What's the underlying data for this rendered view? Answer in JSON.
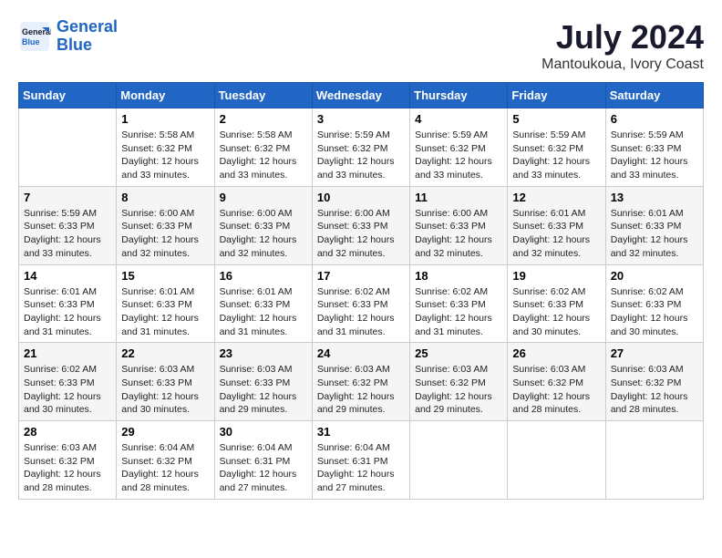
{
  "header": {
    "logo_line1": "General",
    "logo_line2": "Blue",
    "month": "July 2024",
    "location": "Mantoukoua, Ivory Coast"
  },
  "weekdays": [
    "Sunday",
    "Monday",
    "Tuesday",
    "Wednesday",
    "Thursday",
    "Friday",
    "Saturday"
  ],
  "weeks": [
    [
      {
        "day": "",
        "info": ""
      },
      {
        "day": "1",
        "info": "Sunrise: 5:58 AM\nSunset: 6:32 PM\nDaylight: 12 hours\nand 33 minutes."
      },
      {
        "day": "2",
        "info": "Sunrise: 5:58 AM\nSunset: 6:32 PM\nDaylight: 12 hours\nand 33 minutes."
      },
      {
        "day": "3",
        "info": "Sunrise: 5:59 AM\nSunset: 6:32 PM\nDaylight: 12 hours\nand 33 minutes."
      },
      {
        "day": "4",
        "info": "Sunrise: 5:59 AM\nSunset: 6:32 PM\nDaylight: 12 hours\nand 33 minutes."
      },
      {
        "day": "5",
        "info": "Sunrise: 5:59 AM\nSunset: 6:32 PM\nDaylight: 12 hours\nand 33 minutes."
      },
      {
        "day": "6",
        "info": "Sunrise: 5:59 AM\nSunset: 6:33 PM\nDaylight: 12 hours\nand 33 minutes."
      }
    ],
    [
      {
        "day": "7",
        "info": "Sunrise: 5:59 AM\nSunset: 6:33 PM\nDaylight: 12 hours\nand 33 minutes."
      },
      {
        "day": "8",
        "info": "Sunrise: 6:00 AM\nSunset: 6:33 PM\nDaylight: 12 hours\nand 32 minutes."
      },
      {
        "day": "9",
        "info": "Sunrise: 6:00 AM\nSunset: 6:33 PM\nDaylight: 12 hours\nand 32 minutes."
      },
      {
        "day": "10",
        "info": "Sunrise: 6:00 AM\nSunset: 6:33 PM\nDaylight: 12 hours\nand 32 minutes."
      },
      {
        "day": "11",
        "info": "Sunrise: 6:00 AM\nSunset: 6:33 PM\nDaylight: 12 hours\nand 32 minutes."
      },
      {
        "day": "12",
        "info": "Sunrise: 6:01 AM\nSunset: 6:33 PM\nDaylight: 12 hours\nand 32 minutes."
      },
      {
        "day": "13",
        "info": "Sunrise: 6:01 AM\nSunset: 6:33 PM\nDaylight: 12 hours\nand 32 minutes."
      }
    ],
    [
      {
        "day": "14",
        "info": "Sunrise: 6:01 AM\nSunset: 6:33 PM\nDaylight: 12 hours\nand 31 minutes."
      },
      {
        "day": "15",
        "info": "Sunrise: 6:01 AM\nSunset: 6:33 PM\nDaylight: 12 hours\nand 31 minutes."
      },
      {
        "day": "16",
        "info": "Sunrise: 6:01 AM\nSunset: 6:33 PM\nDaylight: 12 hours\nand 31 minutes."
      },
      {
        "day": "17",
        "info": "Sunrise: 6:02 AM\nSunset: 6:33 PM\nDaylight: 12 hours\nand 31 minutes."
      },
      {
        "day": "18",
        "info": "Sunrise: 6:02 AM\nSunset: 6:33 PM\nDaylight: 12 hours\nand 31 minutes."
      },
      {
        "day": "19",
        "info": "Sunrise: 6:02 AM\nSunset: 6:33 PM\nDaylight: 12 hours\nand 30 minutes."
      },
      {
        "day": "20",
        "info": "Sunrise: 6:02 AM\nSunset: 6:33 PM\nDaylight: 12 hours\nand 30 minutes."
      }
    ],
    [
      {
        "day": "21",
        "info": "Sunrise: 6:02 AM\nSunset: 6:33 PM\nDaylight: 12 hours\nand 30 minutes."
      },
      {
        "day": "22",
        "info": "Sunrise: 6:03 AM\nSunset: 6:33 PM\nDaylight: 12 hours\nand 30 minutes."
      },
      {
        "day": "23",
        "info": "Sunrise: 6:03 AM\nSunset: 6:33 PM\nDaylight: 12 hours\nand 29 minutes."
      },
      {
        "day": "24",
        "info": "Sunrise: 6:03 AM\nSunset: 6:32 PM\nDaylight: 12 hours\nand 29 minutes."
      },
      {
        "day": "25",
        "info": "Sunrise: 6:03 AM\nSunset: 6:32 PM\nDaylight: 12 hours\nand 29 minutes."
      },
      {
        "day": "26",
        "info": "Sunrise: 6:03 AM\nSunset: 6:32 PM\nDaylight: 12 hours\nand 28 minutes."
      },
      {
        "day": "27",
        "info": "Sunrise: 6:03 AM\nSunset: 6:32 PM\nDaylight: 12 hours\nand 28 minutes."
      }
    ],
    [
      {
        "day": "28",
        "info": "Sunrise: 6:03 AM\nSunset: 6:32 PM\nDaylight: 12 hours\nand 28 minutes."
      },
      {
        "day": "29",
        "info": "Sunrise: 6:04 AM\nSunset: 6:32 PM\nDaylight: 12 hours\nand 28 minutes."
      },
      {
        "day": "30",
        "info": "Sunrise: 6:04 AM\nSunset: 6:31 PM\nDaylight: 12 hours\nand 27 minutes."
      },
      {
        "day": "31",
        "info": "Sunrise: 6:04 AM\nSunset: 6:31 PM\nDaylight: 12 hours\nand 27 minutes."
      },
      {
        "day": "",
        "info": ""
      },
      {
        "day": "",
        "info": ""
      },
      {
        "day": "",
        "info": ""
      }
    ]
  ]
}
